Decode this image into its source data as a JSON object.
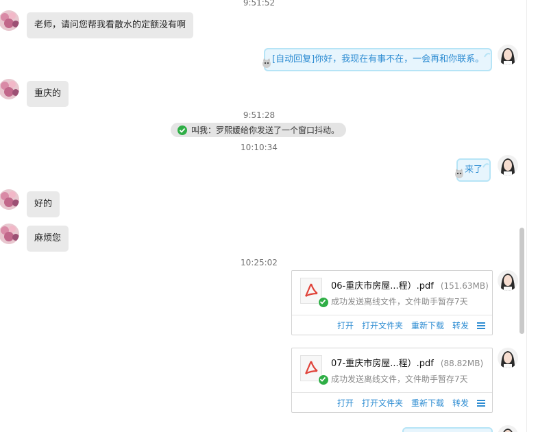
{
  "timestamps": [
    "9:51:52",
    "9:51:28",
    "10:10:34",
    "10:25:02"
  ],
  "messages": {
    "m1": "老师，请问您帮我看散水的定额没有啊",
    "auto_reply": "[自动回复]你好，我现在有事不在，一会再和你联系。",
    "m2": "重庆的",
    "notice": "叫我：罗熙媛给你发送了一个窗口抖动。",
    "reply_come": "来了",
    "m3": "好的",
    "m4": "麻烦您"
  },
  "files": [
    {
      "name": "06-重庆市房屋...程）.pdf",
      "size": "(151.63MB)",
      "status": "成功发送离线文件，文件助手暂存7天"
    },
    {
      "name": "07-重庆市房屋...程）.pdf",
      "size": "(88.82MB)",
      "status": "成功发送离线文件，文件助手暂存7天"
    }
  ],
  "file_actions": {
    "open": "打开",
    "open_folder": "打开文件夹",
    "redownload": "重新下载",
    "forward": "转发"
  },
  "icons": {
    "file": "pdf-file-icon",
    "success": "check-circle-icon",
    "more": "menu-icon"
  },
  "colors": {
    "link": "#2d8cd2",
    "incoming_bubble": "#e9e9e9",
    "outgoing_bubble": "#e7f5fd",
    "success": "#2fae46"
  }
}
